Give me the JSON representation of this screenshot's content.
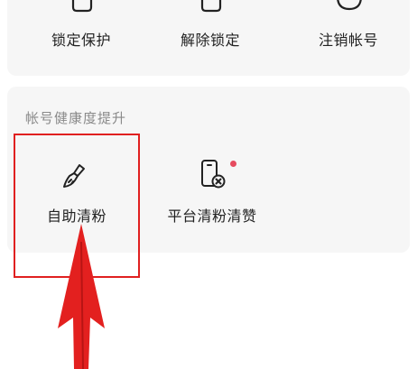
{
  "top_actions": [
    {
      "label": "锁定保护",
      "icon": "lock-device-icon"
    },
    {
      "label": "解除锁定",
      "icon": "unlock-device-icon"
    },
    {
      "label": "注销帐号",
      "icon": "deactivate-account-icon"
    }
  ],
  "health_section": {
    "title": "帐号健康度提升",
    "items": [
      {
        "label": "自助清粉",
        "icon": "broom-icon"
      },
      {
        "label": "平台清粉清赞",
        "icon": "phone-clean-icon",
        "badge": "red-dot"
      }
    ]
  },
  "colors": {
    "highlight": "#e02020",
    "arrow": "#e3201f",
    "badge": "#e64b5f",
    "card": "#f6f6f6"
  }
}
